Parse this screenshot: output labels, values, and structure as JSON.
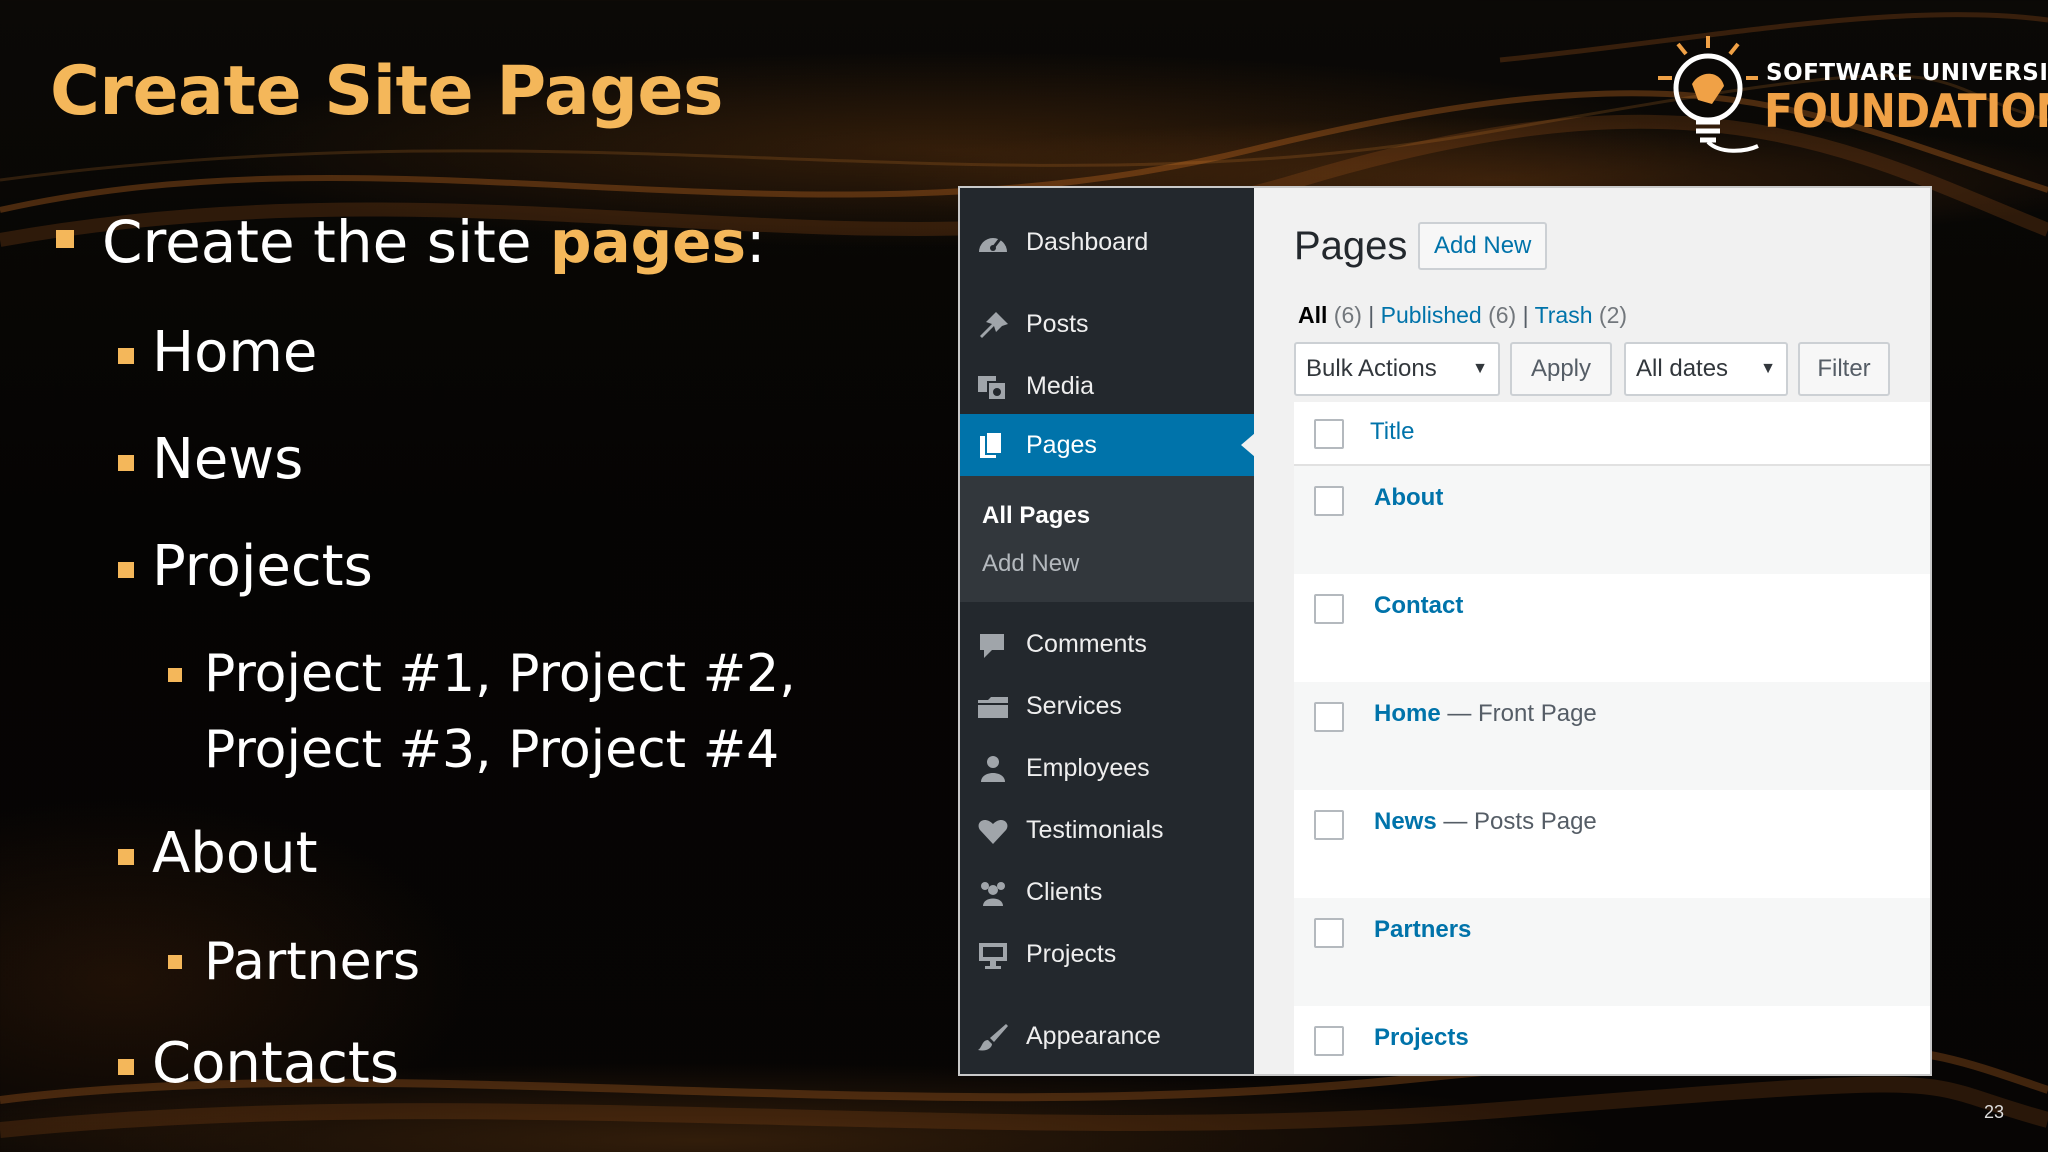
{
  "slide": {
    "title": "Create Site Pages",
    "number": "23"
  },
  "logo": {
    "line1": "SOFTWARE UNIVERSITY",
    "line2": "FOUNDATION"
  },
  "bullets": {
    "main_prefix": "Create the site ",
    "main_highlight": "pages",
    "main_suffix": ":",
    "home": "Home",
    "news": "News",
    "projects": "Projects",
    "projects_sub_line1": "Project #1, Project #2,",
    "projects_sub_line2": "Project #3, Project #4",
    "about": "About",
    "partners": "Partners",
    "contacts": "Contacts"
  },
  "colors": {
    "accent": "#f4b75a",
    "wp_sidebar": "#23282d",
    "wp_active": "#0073aa",
    "wp_link": "#0073aa"
  },
  "wp": {
    "sidebar": {
      "items": [
        {
          "label": "Dashboard",
          "icon": "dashboard-icon"
        },
        {
          "label": "Posts",
          "icon": "pin-icon"
        },
        {
          "label": "Media",
          "icon": "media-icon"
        },
        {
          "label": "Pages",
          "icon": "pages-icon"
        },
        {
          "label": "Comments",
          "icon": "comment-icon"
        },
        {
          "label": "Services",
          "icon": "folder-icon"
        },
        {
          "label": "Employees",
          "icon": "person-icon"
        },
        {
          "label": "Testimonials",
          "icon": "heart-icon"
        },
        {
          "label": "Clients",
          "icon": "group-icon"
        },
        {
          "label": "Projects",
          "icon": "monitor-icon"
        },
        {
          "label": "Appearance",
          "icon": "brush-icon"
        }
      ],
      "submenu": [
        "All Pages",
        "Add New"
      ]
    },
    "main": {
      "heading": "Pages",
      "add_new": "Add New",
      "views": {
        "all": "All",
        "all_count": "(6)",
        "published": "Published",
        "published_count": "(6)",
        "trash": "Trash",
        "trash_count": "(2)",
        "sep": "|"
      },
      "bulk_actions": "Bulk Actions",
      "apply": "Apply",
      "all_dates": "All dates",
      "filter": "Filter",
      "column_title": "Title",
      "rows": [
        {
          "title": "About",
          "state": ""
        },
        {
          "title": "Contact",
          "state": ""
        },
        {
          "title": "Home",
          "state": " — Front Page"
        },
        {
          "title": "News",
          "state": " — Posts Page"
        },
        {
          "title": "Partners",
          "state": ""
        },
        {
          "title": "Projects",
          "state": ""
        }
      ]
    }
  }
}
